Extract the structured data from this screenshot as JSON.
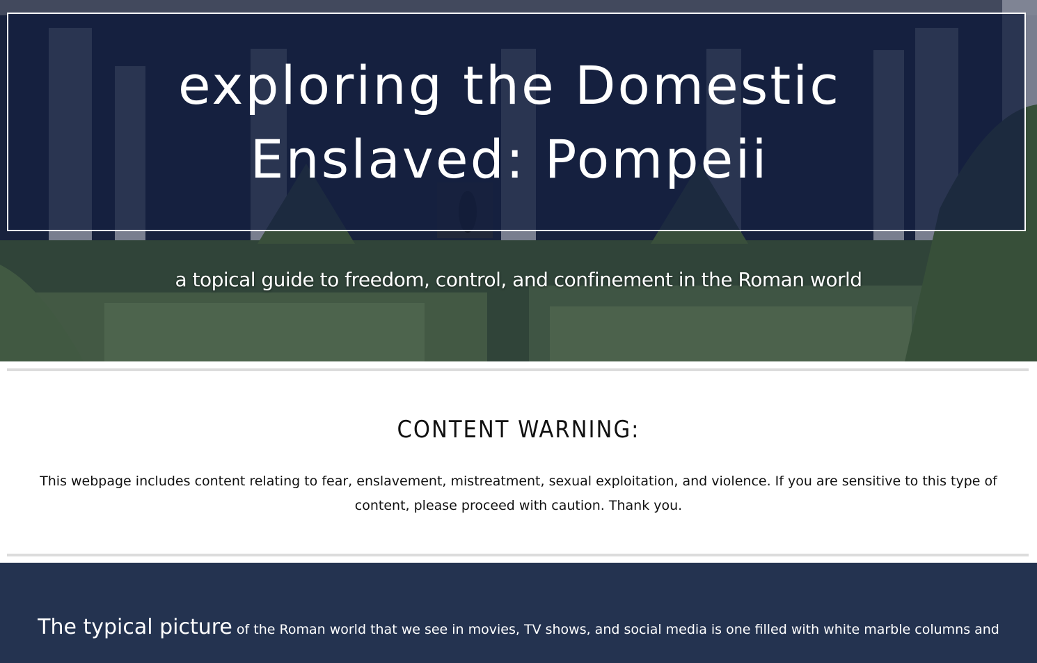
{
  "hero": {
    "title": "exploring the Domestic Enslaved: Pompeii",
    "subtitle": "a topical guide to freedom, control, and confinement in the Roman world"
  },
  "warning": {
    "heading": "CONTENT WARNING:",
    "body": "This webpage includes content relating to fear, enslavement, mistreatment, sexual exploitation, and violence. If you are sensitive to this type of content, please proceed with caution. Thank you."
  },
  "intro": {
    "lead": "The typical picture",
    "text": " of the Roman world that we see in movies, TV shows, and social media is one filled with white marble columns and"
  },
  "colors": {
    "navy": "#243350",
    "title_box": "#14203f",
    "divider": "#dcdcdc"
  }
}
